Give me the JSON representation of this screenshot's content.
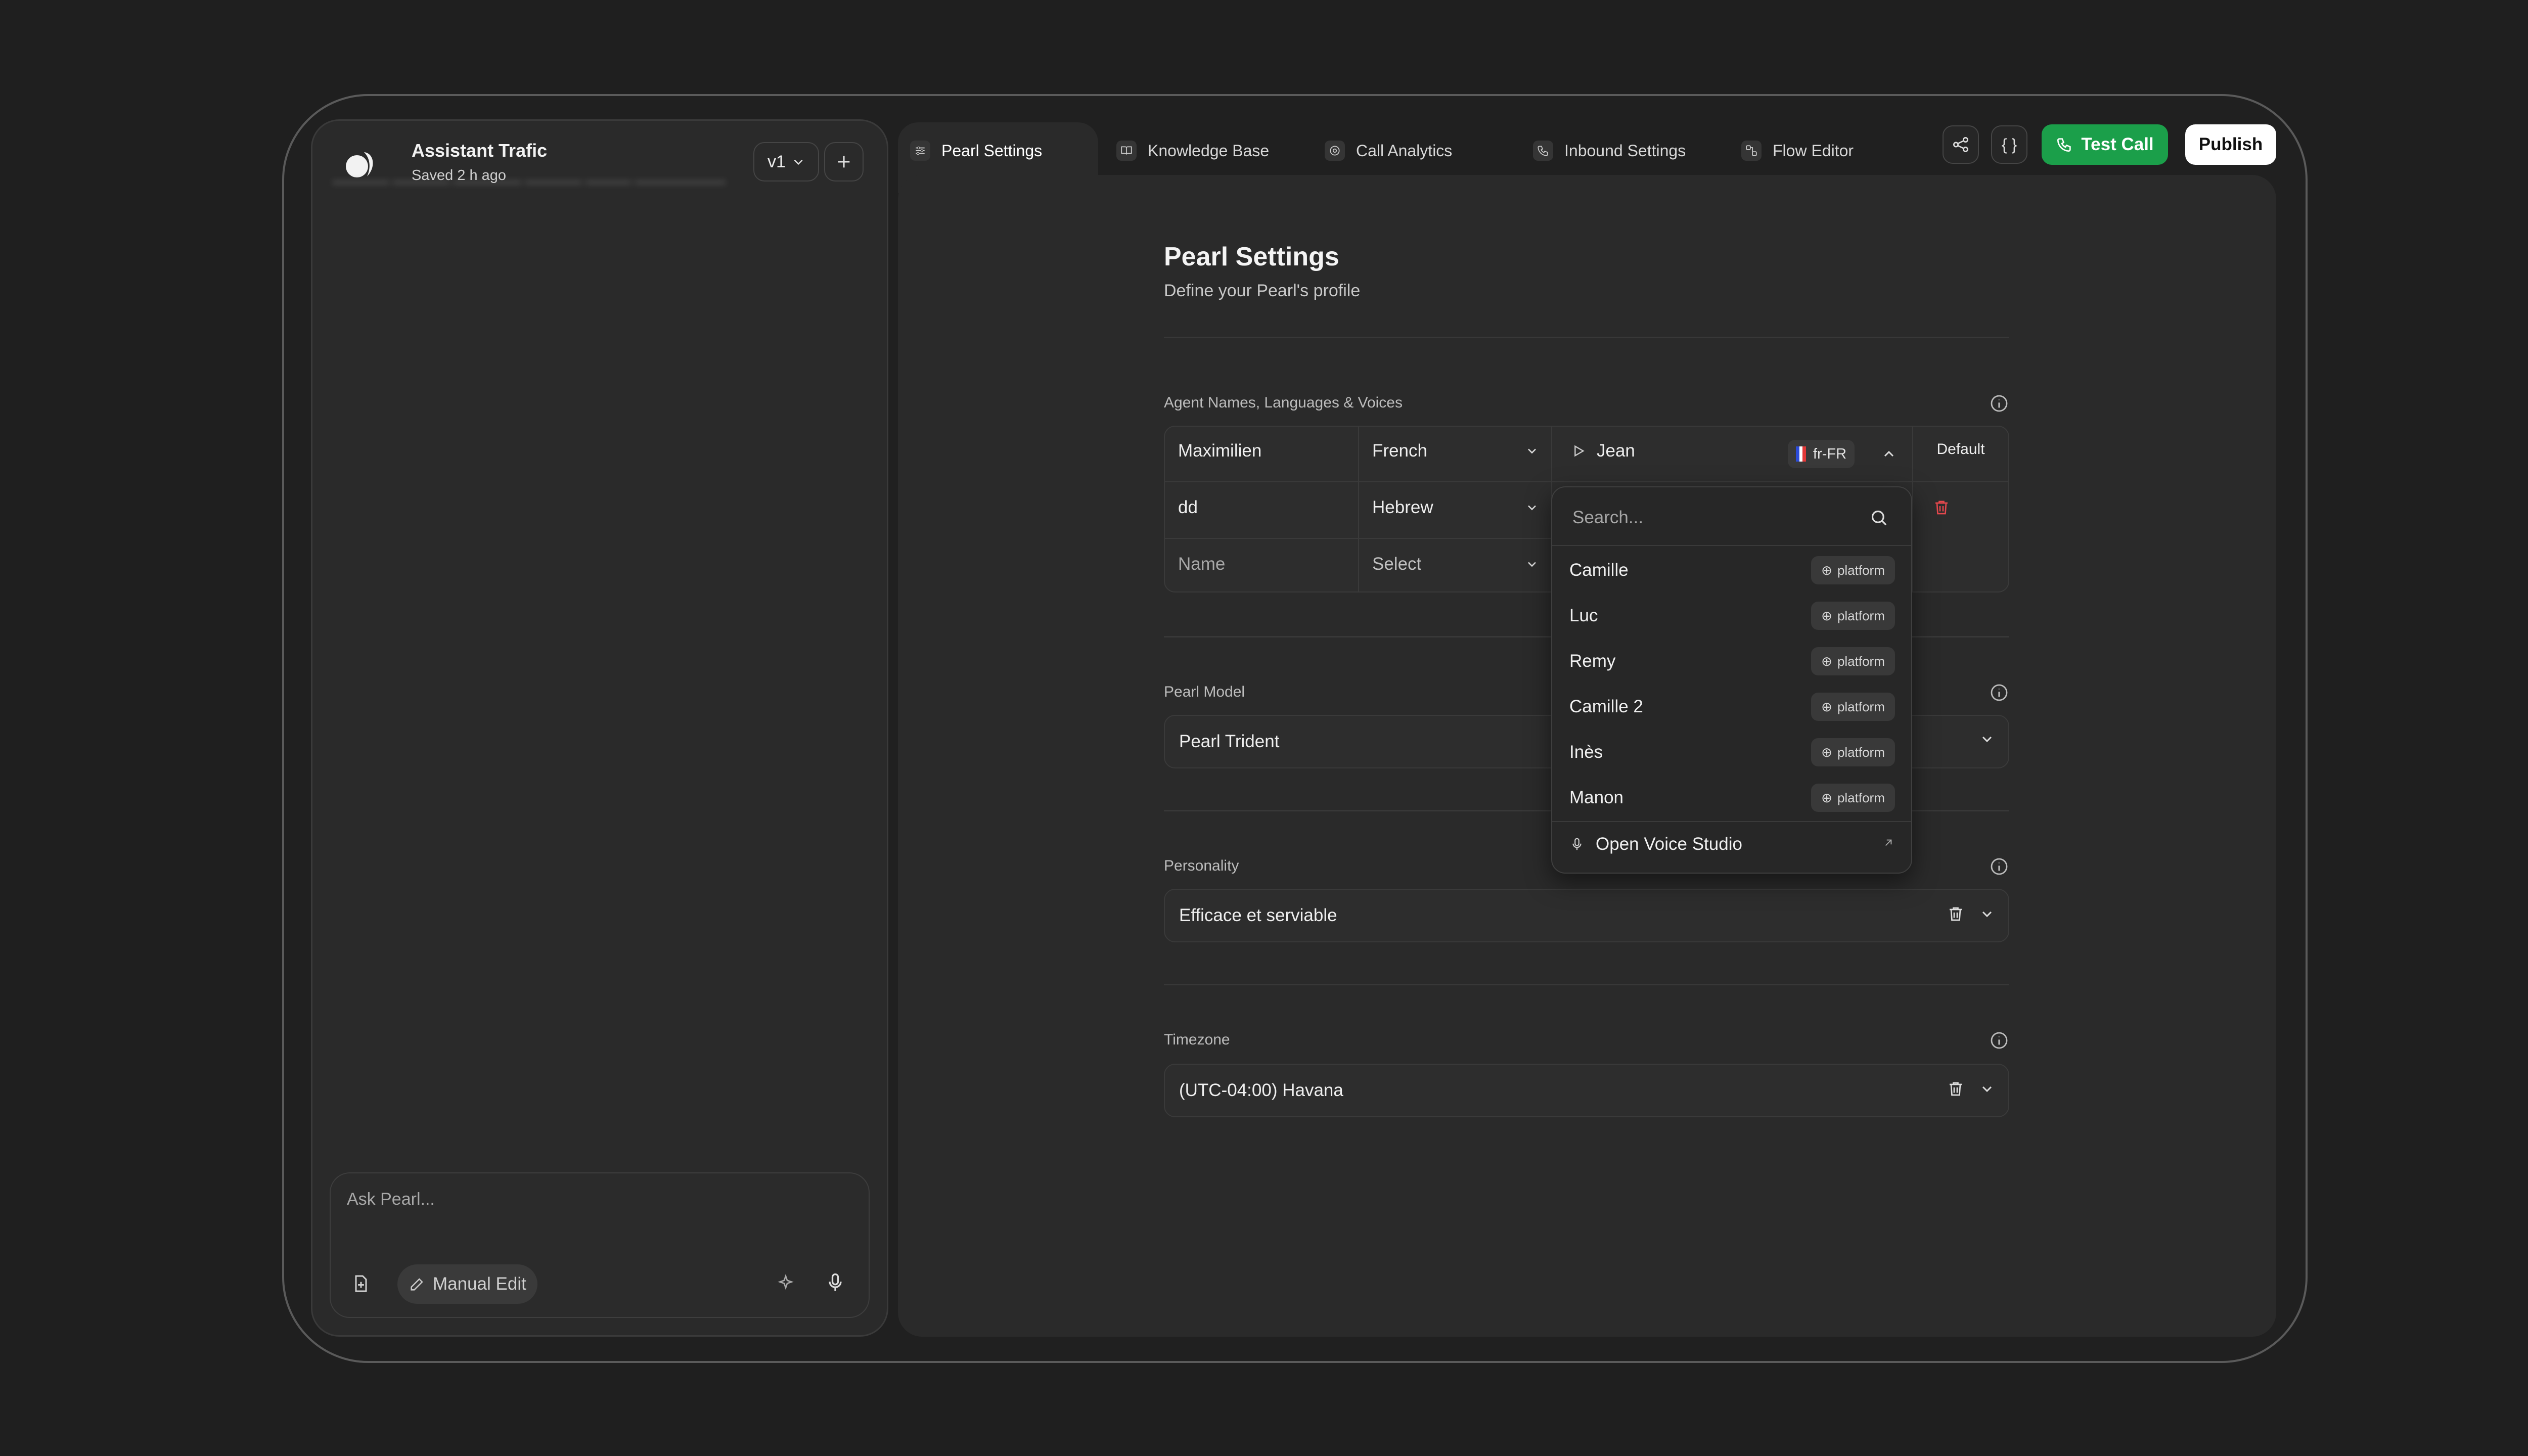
{
  "sidebar": {
    "assistant_name": "Assistant Trafic",
    "saved_status": "Saved 2 h ago",
    "version": "v1",
    "chat": {
      "placeholder": "Ask Pearl...",
      "manual_edit_label": "Manual Edit"
    }
  },
  "tabs": [
    {
      "label": "Pearl Settings",
      "icon": "sliders-icon",
      "active": true
    },
    {
      "label": "Knowledge Base",
      "icon": "book-icon",
      "active": false
    },
    {
      "label": "Call Analytics",
      "icon": "chart-icon",
      "active": false
    },
    {
      "label": "Inbound Settings",
      "icon": "phone-incoming-icon",
      "active": false
    },
    {
      "label": "Flow Editor",
      "icon": "flow-icon",
      "active": false
    }
  ],
  "toolbar": {
    "code_label": "{ }",
    "test_call_label": "Test Call",
    "publish_label": "Publish"
  },
  "page": {
    "title": "Pearl Settings",
    "subtitle": "Define your Pearl's profile"
  },
  "agents": {
    "section_label": "Agent Names, Languages & Voices",
    "rows": [
      {
        "name": "Maximilien",
        "language": "French",
        "voice": "Jean",
        "locale": "fr-FR",
        "tag": "Default"
      },
      {
        "name": "dd",
        "language": "Hebrew"
      },
      {
        "name": "Name",
        "language": "Select"
      }
    ]
  },
  "voice_dropdown": {
    "search_placeholder": "Search...",
    "items": [
      {
        "name": "Camille",
        "tag": "platform"
      },
      {
        "name": "Luc",
        "tag": "platform"
      },
      {
        "name": "Remy",
        "tag": "platform"
      },
      {
        "name": "Camille 2",
        "tag": "platform"
      },
      {
        "name": "Inès",
        "tag": "platform"
      },
      {
        "name": "Manon",
        "tag": "platform"
      }
    ],
    "open_studio_label": "Open Voice Studio"
  },
  "model": {
    "label": "Pearl Model",
    "value": "Pearl Trident"
  },
  "personality": {
    "label": "Personality",
    "value": "Efficace et serviable"
  },
  "timezone": {
    "label": "Timezone",
    "value": "(UTC-04:00) Havana"
  },
  "colors": {
    "accent_green": "#1b9f4a",
    "delete_red": "#e5484d",
    "background": "#1f1f1f",
    "panel": "#2a2a2a"
  }
}
